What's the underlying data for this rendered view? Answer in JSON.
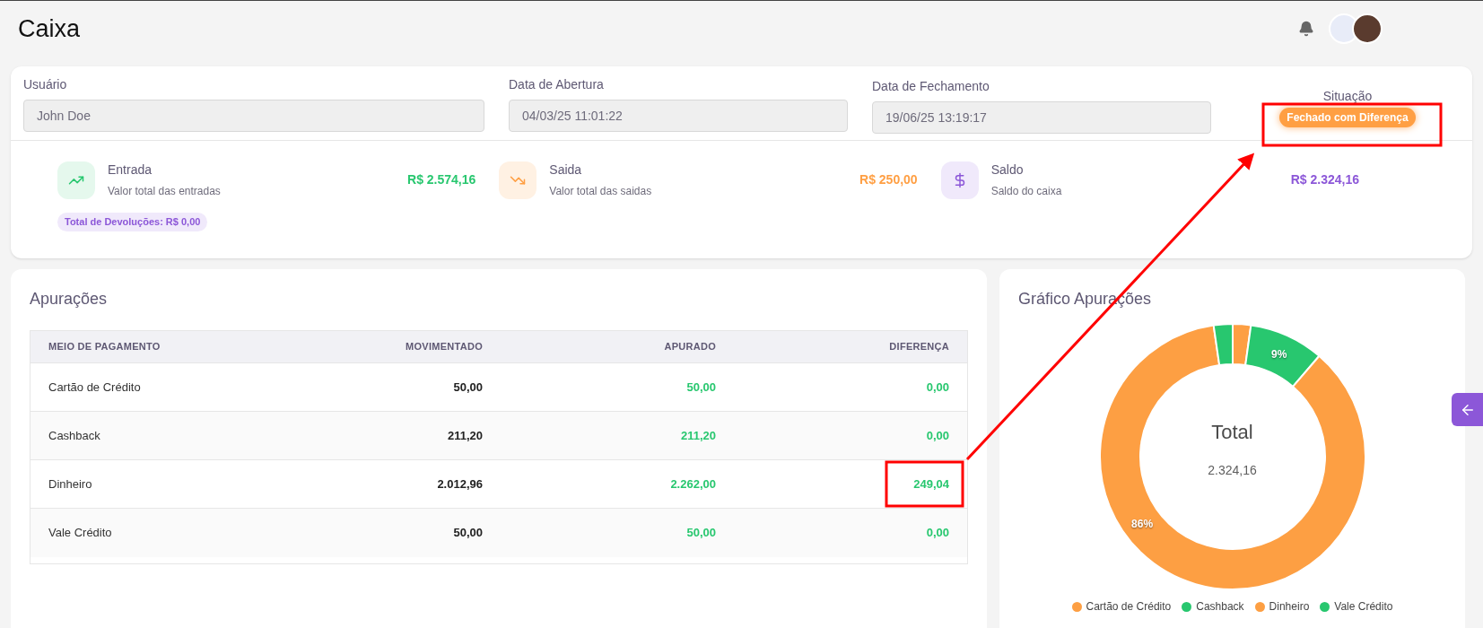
{
  "page": {
    "title": "Caixa"
  },
  "fields": [
    {
      "label": "Usuário",
      "value": "John Doe"
    },
    {
      "label": "Data de Abertura",
      "value": "04/03/25 11:01:22"
    },
    {
      "label": "Data de Fechamento",
      "value": "19/06/25 13:19:17"
    }
  ],
  "status": {
    "label": "Situação",
    "value": "Fechado com Diferença"
  },
  "stats": [
    {
      "kind": "in",
      "title": "Entrada",
      "subtitle": "Valor total das entradas",
      "amount": "R$ 2.574,16"
    },
    {
      "kind": "out",
      "title": "Saida",
      "subtitle": "Valor total das saidas",
      "amount": "R$ 250,00"
    },
    {
      "kind": "balance",
      "title": "Saldo",
      "subtitle": "Saldo do caixa",
      "amount": "R$ 2.324,16"
    }
  ],
  "returns_badge": "Total de Devoluções: R$ 0,00",
  "table": {
    "title": "Apurações",
    "columns": [
      "MEIO DE PAGAMENTO",
      "MOVIMENTADO",
      "APURADO",
      "DIFERENÇA"
    ],
    "rows": [
      [
        "Cartão de Crédito",
        "50,00",
        "50,00",
        "0,00"
      ],
      [
        "Cashback",
        "211,20",
        "211,20",
        "0,00"
      ],
      [
        "Dinheiro",
        "2.012,96",
        "2.262,00",
        "249,04"
      ],
      [
        "Vale Crédito",
        "50,00",
        "50,00",
        "0,00"
      ]
    ]
  },
  "chart_panel": {
    "title": "Gráfico Apurações",
    "center_title": "Total",
    "center_value": "2.324,16",
    "chart_data": {
      "type": "donut",
      "values": [
        2.2,
        9.1,
        86.4,
        2.3
      ],
      "value_labels": [
        null,
        "9%",
        "86%",
        null
      ]
    },
    "legend": [
      {
        "label": "Cartão de Crédito",
        "color": "#fd9f43"
      },
      {
        "label": "Cashback",
        "color": "#28c76f"
      },
      {
        "label": "Dinheiro",
        "color": "#fd9f43"
      },
      {
        "label": "Vale Crédito",
        "color": "#28c76f"
      }
    ]
  }
}
